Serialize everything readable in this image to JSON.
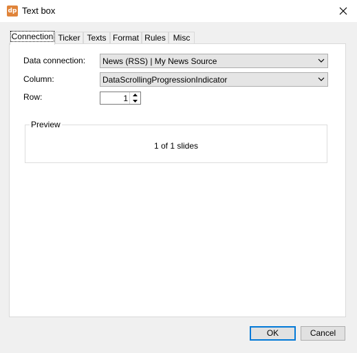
{
  "window": {
    "title": "Text box",
    "icon_text": "dp",
    "icon_color": "#e0843a"
  },
  "tabs": [
    {
      "label": "Connection",
      "active": true
    },
    {
      "label": "Ticker",
      "active": false
    },
    {
      "label": "Texts",
      "active": false
    },
    {
      "label": "Format",
      "active": false
    },
    {
      "label": "Rules",
      "active": false
    },
    {
      "label": "Misc",
      "active": false
    }
  ],
  "connection": {
    "data_connection_label": "Data connection:",
    "data_connection_value": "News (RSS) | My News Source",
    "column_label": "Column:",
    "column_value": "DataScrollingProgressionIndicator",
    "row_label": "Row:",
    "row_value": "1"
  },
  "preview": {
    "title": "Preview",
    "text": "1 of 1 slides"
  },
  "buttons": {
    "ok": "OK",
    "cancel": "Cancel"
  },
  "colors": {
    "accent": "#0078d7"
  }
}
